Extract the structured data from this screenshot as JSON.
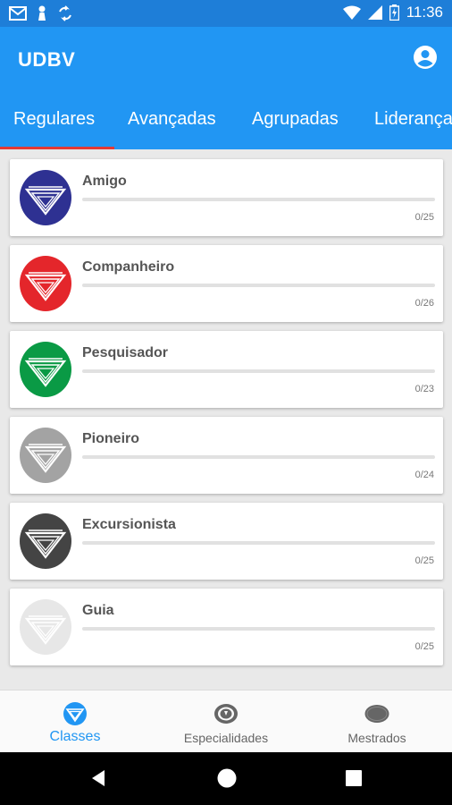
{
  "status_bar": {
    "time": "11:36"
  },
  "app_bar": {
    "title": "UDBV",
    "account_icon": "account-circle-icon"
  },
  "tabs": [
    {
      "label": "Regulares",
      "active": true
    },
    {
      "label": "Avançadas",
      "active": false
    },
    {
      "label": "Agrupadas",
      "active": false
    },
    {
      "label": "Liderança",
      "active": false
    }
  ],
  "classes": [
    {
      "name": "Amigo",
      "progress": "0/25",
      "completed": 0,
      "total": 25,
      "color": "#2e3192"
    },
    {
      "name": "Companheiro",
      "progress": "0/26",
      "completed": 0,
      "total": 26,
      "color": "#e4262b"
    },
    {
      "name": "Pesquisador",
      "progress": "0/23",
      "completed": 0,
      "total": 23,
      "color": "#0a9a45"
    },
    {
      "name": "Pioneiro",
      "progress": "0/24",
      "completed": 0,
      "total": 24,
      "color": "#a3a3a3"
    },
    {
      "name": "Excursionista",
      "progress": "0/25",
      "completed": 0,
      "total": 25,
      "color": "#444444"
    },
    {
      "name": "Guia",
      "progress": "0/25",
      "completed": 0,
      "total": 25,
      "color": "#e7e7e7"
    }
  ],
  "bottom_nav": [
    {
      "label": "Classes",
      "icon": "classes-emblem-icon",
      "active": true
    },
    {
      "label": "Especialidades",
      "icon": "specialty-badge-icon",
      "active": false
    },
    {
      "label": "Mestrados",
      "icon": "master-badge-icon",
      "active": false
    }
  ],
  "colors": {
    "primary": "#2196f3",
    "status_bar": "#1e7ed8",
    "tab_indicator": "#e53935"
  }
}
